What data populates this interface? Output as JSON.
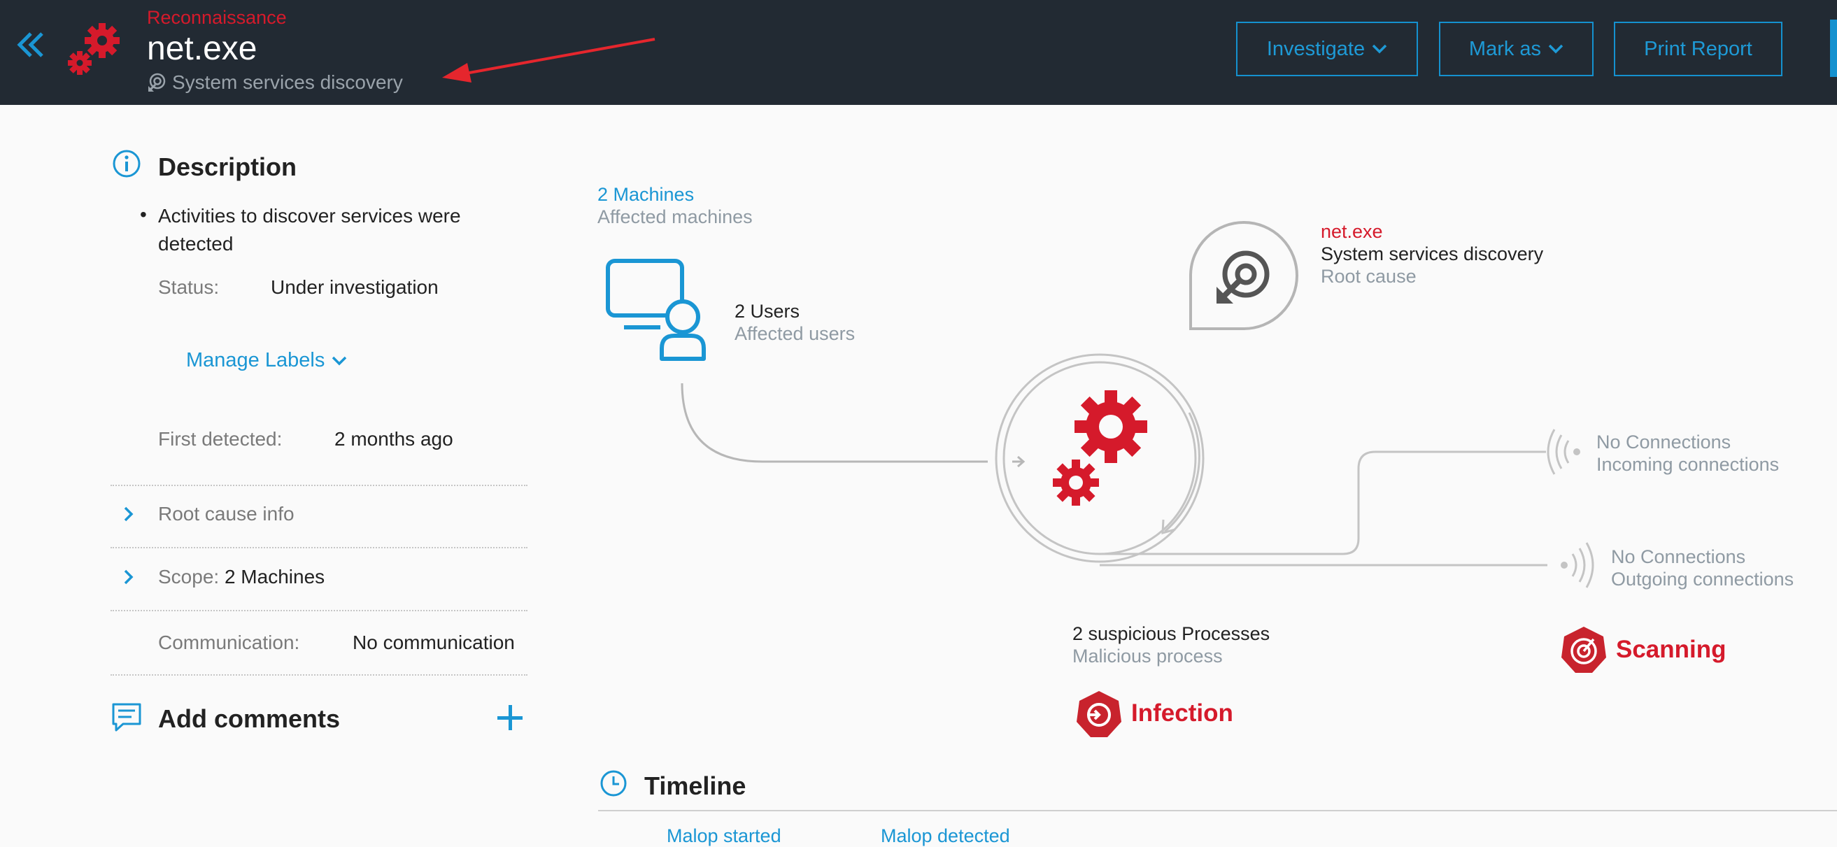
{
  "header": {
    "category": "Reconnaissance",
    "title": "net.exe",
    "subtitle": "System services discovery",
    "buttons": {
      "investigate": "Investigate",
      "mark_as": "Mark as",
      "print_report": "Print Report"
    }
  },
  "sidebar": {
    "description_title": "Description",
    "description_bullet_line1": "Activities to discover services were",
    "description_bullet_line2": "detected",
    "status_label": "Status:",
    "status_value": "Under investigation",
    "manage_labels": "Manage Labels",
    "first_detected_label": "First detected:",
    "first_detected_value": "2 months ago",
    "root_cause_info": "Root cause info",
    "scope_label": "Scope:",
    "scope_value": "2 Machines",
    "communication_label": "Communication:",
    "communication_value": "No communication",
    "add_comments": "Add comments"
  },
  "graph": {
    "machines_count": "2 Machines",
    "machines_label": "Affected machines",
    "users_count": "2 Users",
    "users_label": "Affected users",
    "root_name": "net.exe",
    "root_desc": "System services discovery",
    "root_label": "Root cause",
    "incoming_title": "No Connections",
    "incoming_label": "Incoming connections",
    "outgoing_title": "No Connections",
    "outgoing_label": "Outgoing connections",
    "processes_title": "2 suspicious Processes",
    "processes_label": "Malicious process",
    "infection": "Infection",
    "scanning": "Scanning"
  },
  "timeline": {
    "title": "Timeline",
    "malop_started": "Malop started",
    "malop_detected": "Malop detected"
  },
  "colors": {
    "accent": "#1a96d4",
    "danger": "#d51a2b",
    "header_bg": "#222a33"
  }
}
